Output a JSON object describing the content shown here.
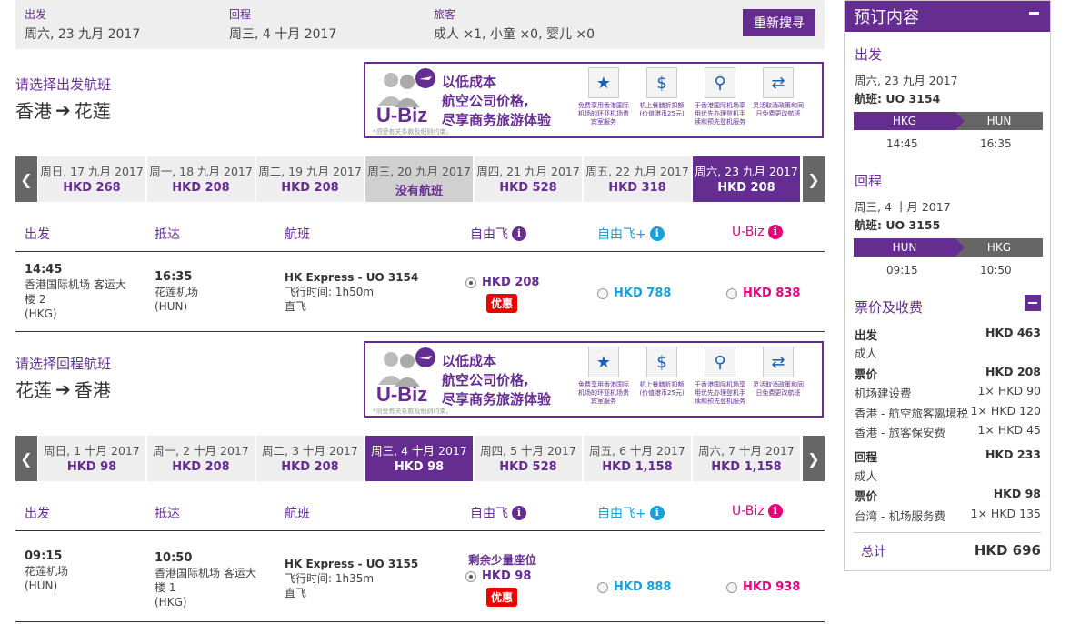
{
  "search": {
    "depart_label": "出发",
    "depart_value": "周六, 23 九月 2017",
    "return_label": "回程",
    "return_value": "周三, 4 十月 2017",
    "pax_label": "旅客",
    "pax_value": "成人 ×1, 小童 ×0, 婴儿 ×0",
    "resubmit": "重新搜寻"
  },
  "banner": {
    "brand": "U-Biz",
    "slogan": [
      "以低成本",
      "航空公司价格,",
      "尽享商务旅游体验"
    ],
    "fineprint": "*须受有关条款及细则约束。",
    "features": [
      {
        "icon": "star-person-icon",
        "text": "免费享用香港国际机场的环亚机场贵宾室服务"
      },
      {
        "icon": "money-icon",
        "text": "机上餐膳折扣额 (价值港币25元)"
      },
      {
        "icon": "counter-icon",
        "text": "于香港国际机场享用优先办理登机手续和预先登机服务"
      },
      {
        "icon": "change-icon",
        "text": "灵活取消政策和同日免费更改航班"
      }
    ]
  },
  "outbound": {
    "title": "请选择出发航班",
    "from": "香港",
    "to": "花莲",
    "dates": [
      {
        "date": "周日, 17 九月 2017",
        "price": "HKD 268",
        "state": "normal"
      },
      {
        "date": "周一, 18 九月 2017",
        "price": "HKD 208",
        "state": "normal"
      },
      {
        "date": "周二, 19 九月 2017",
        "price": "HKD 208",
        "state": "normal"
      },
      {
        "date": "周三, 20 九月 2017",
        "price": "没有航班",
        "state": "na"
      },
      {
        "date": "周四, 21 九月 2017",
        "price": "HKD 528",
        "state": "normal"
      },
      {
        "date": "周五, 22 九月 2017",
        "price": "HKD 318",
        "state": "normal"
      },
      {
        "date": "周六, 23 九月 2017",
        "price": "HKD 208",
        "state": "sel"
      }
    ],
    "flight": {
      "dep_time": "14:45",
      "dep_place": [
        "香港国际机场 客运大",
        "楼 2",
        "(HKG)"
      ],
      "arr_time": "16:35",
      "arr_place": [
        "花莲机场",
        "(HUN)"
      ],
      "flight_no": "HK Express - UO 3154",
      "duration": "飞行时间: 1h50m",
      "stops": "直飞",
      "fare1": "HKD 208",
      "fare2": "HKD 788",
      "fare3": "HKD 838",
      "promo": "优惠",
      "note": ""
    }
  },
  "inbound": {
    "title": "请选择回程航班",
    "from": "花莲",
    "to": "香港",
    "dates": [
      {
        "date": "周日, 1 十月 2017",
        "price": "HKD 98",
        "state": "normal"
      },
      {
        "date": "周一, 2 十月 2017",
        "price": "HKD 208",
        "state": "normal"
      },
      {
        "date": "周二, 3 十月 2017",
        "price": "HKD 208",
        "state": "normal"
      },
      {
        "date": "周三, 4 十月 2017",
        "price": "HKD 98",
        "state": "sel"
      },
      {
        "date": "周四, 5 十月 2017",
        "price": "HKD 528",
        "state": "normal"
      },
      {
        "date": "周五, 6 十月 2017",
        "price": "HKD 1,158",
        "state": "normal"
      },
      {
        "date": "周六, 7 十月 2017",
        "price": "HKD 1,158",
        "state": "normal"
      }
    ],
    "flight": {
      "dep_time": "09:15",
      "dep_place": [
        "花莲机场",
        "(HUN)"
      ],
      "arr_time": "10:50",
      "arr_place": [
        "香港国际机场 客运大",
        "楼 1",
        "(HKG)"
      ],
      "flight_no": "HK Express - UO 3155",
      "duration": "飞行时间: 1h35m",
      "stops": "直飞",
      "fare1": "HKD 98",
      "fare2": "HKD 888",
      "fare3": "HKD 938",
      "promo": "优惠",
      "note": "剩余少量座位"
    }
  },
  "columns": {
    "depart": "出发",
    "arrive": "抵达",
    "flight": "航班",
    "fare1": "自由飞",
    "fare2": "自由飞+",
    "fare3": "U-Biz"
  },
  "colors": {
    "brand": "#662d91",
    "fare2": "#1a9fd9",
    "fare3": "#e5007e",
    "promo": "#e00000"
  },
  "summary": {
    "title": "预订内容",
    "out_label": "出发",
    "out_date": "周六, 23 九月 2017",
    "out_flight": "航班: UO 3154",
    "out_from": "HKG",
    "out_to": "HUN",
    "out_dep": "14:45",
    "out_arr": "16:35",
    "ret_label": "回程",
    "ret_date": "周三, 4 十月 2017",
    "ret_flight": "航班: UO 3155",
    "ret_from": "HUN",
    "ret_to": "HKG",
    "ret_dep": "09:15",
    "ret_arr": "10:50",
    "fees_title": "票价及收费",
    "o_label": "出发",
    "o_total": "HKD 463",
    "o_pax": "成人",
    "o_fare_label": "票价",
    "o_fare": "HKD 208",
    "o_fee1_label": "机场建设费",
    "o_fee1": "1× HKD 90",
    "o_fee2_label": "香港 - 航空旅客离境税",
    "o_fee2": "1× HKD 120",
    "o_fee3_label": "香港 - 旅客保安费",
    "o_fee3": "1× HKD 45",
    "r_label": "回程",
    "r_total": "HKD 233",
    "r_pax": "成人",
    "r_fare_label": "票价",
    "r_fare": "HKD 98",
    "r_fee1_label": "台湾 - 机场服务费",
    "r_fee1": "1× HKD 135",
    "total_label": "总计",
    "total": "HKD 696"
  }
}
